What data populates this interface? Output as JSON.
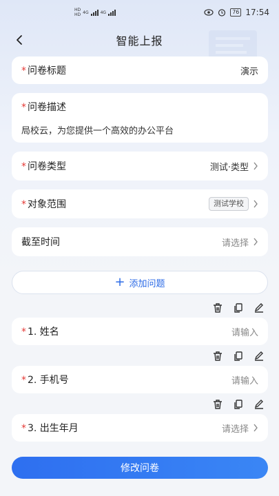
{
  "status_bar": {
    "net1": "HD",
    "net2": "HD",
    "sig1": "4G",
    "sig2": "4G",
    "battery": "76",
    "time": "17:54"
  },
  "nav": {
    "title": "智能上报"
  },
  "form": {
    "survey_title": {
      "required": "*",
      "label": "问卷标题",
      "value": "演示"
    },
    "survey_desc": {
      "required": "*",
      "label": "问卷描述",
      "value": "局校云，为您提供一个高效的办公平台"
    },
    "survey_type": {
      "required": "*",
      "label": "问卷类型",
      "value": "测试·类型"
    },
    "target_scope": {
      "required": "*",
      "label": "对象范围",
      "value": "测试学校"
    },
    "deadline": {
      "label": "截至时间",
      "placeholder": "请选择"
    }
  },
  "add_question": {
    "icon": "+",
    "label": "添加问题"
  },
  "questions": [
    {
      "required": "*",
      "label": "1. 姓名",
      "placeholder": "请输入"
    },
    {
      "required": "*",
      "label": "2. 手机号",
      "placeholder": "请输入"
    },
    {
      "required": "*",
      "label": "3. 出生年月",
      "placeholder": "请选择"
    }
  ],
  "submit": {
    "label": "修改问卷"
  },
  "colors": {
    "accent": "#2e6ff0",
    "required": "#e53935"
  }
}
